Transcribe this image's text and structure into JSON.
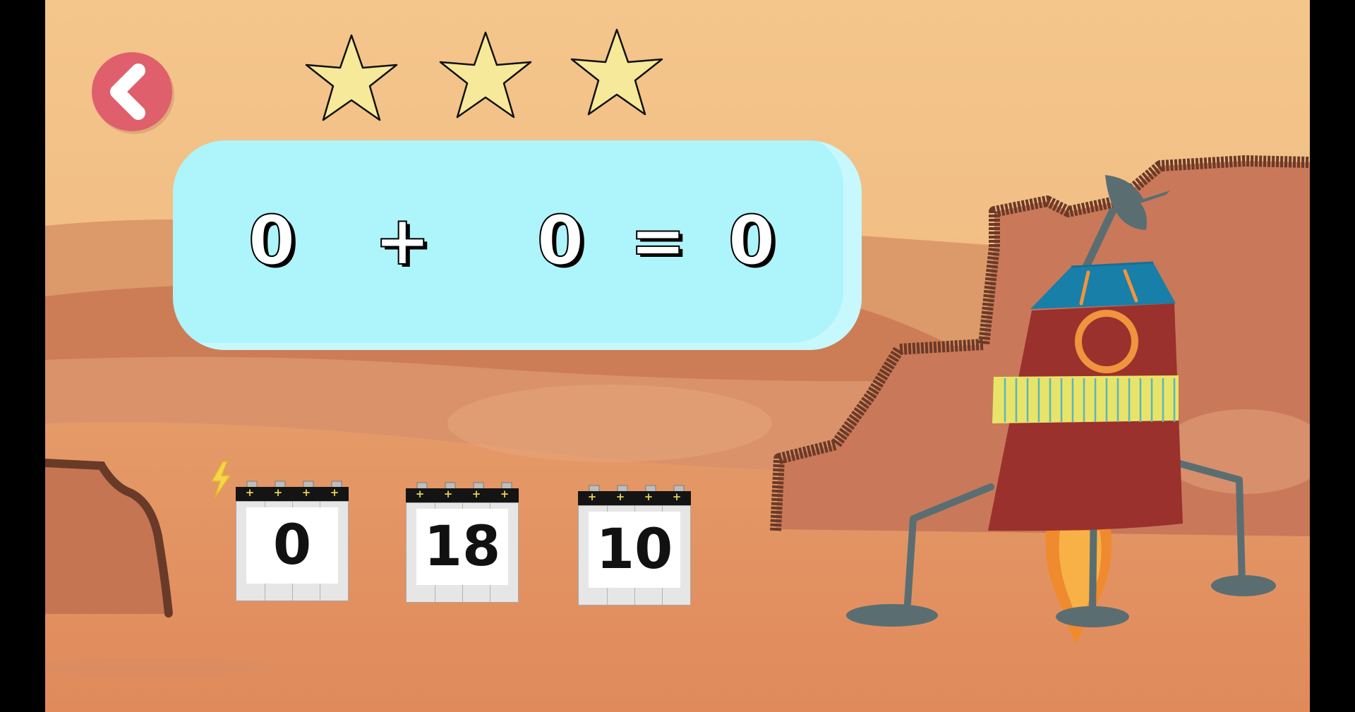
{
  "stars": {
    "earned": 3,
    "total": 3,
    "color": "#f7e99a"
  },
  "equation": {
    "operand1": "0",
    "operator": "+",
    "operand2": "0",
    "equals": "=",
    "result": "0"
  },
  "answer_choices": [
    "0",
    "18",
    "10"
  ],
  "battery_terminal_symbol": "+",
  "icons": {
    "back": "chevron-left-icon",
    "energy": "lightning-bolt-icon",
    "star": "star-icon"
  },
  "colors": {
    "back_button": "#e05f6c",
    "equation_panel": "#aef4fb",
    "bolt": "#f3d649",
    "desert_sky": "#f2bd80",
    "desert_ground": "#e08a5c"
  }
}
